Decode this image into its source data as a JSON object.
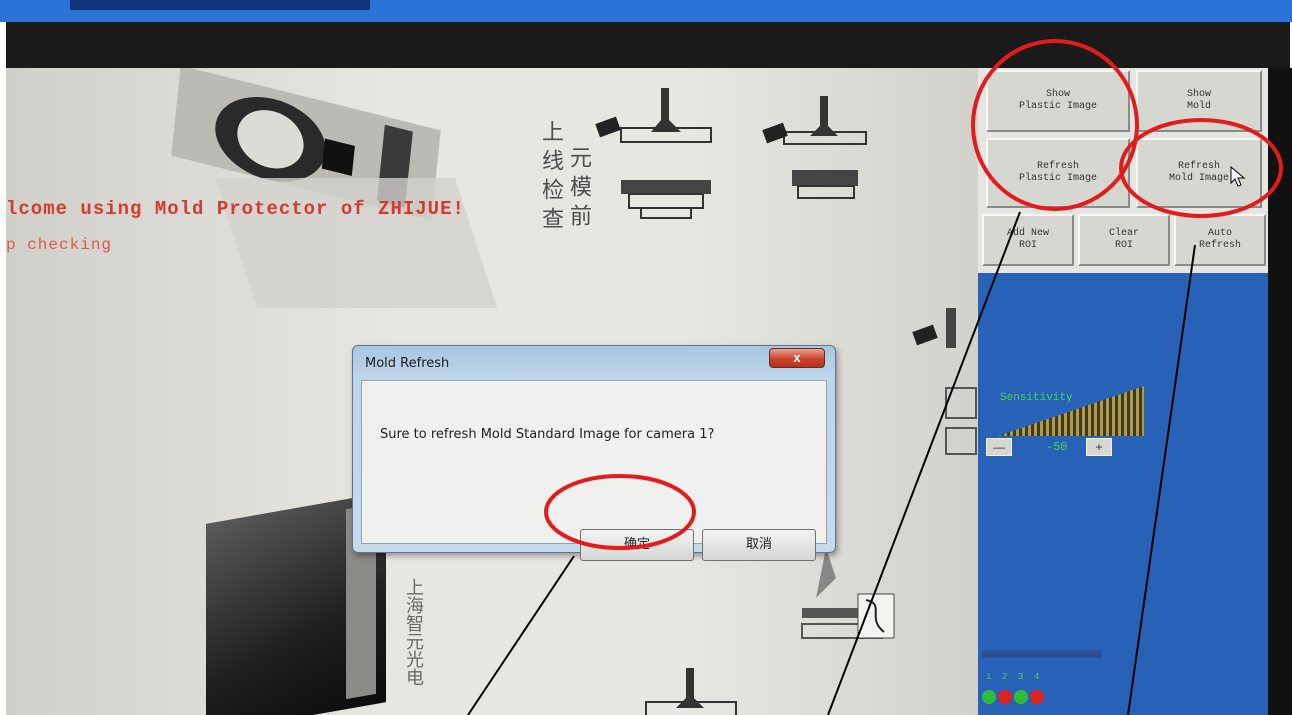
{
  "window": {
    "title_bar_color": "#2a73d6"
  },
  "screen": {
    "welcome_line": "lcome using Mold Protector of ZHIJUE!",
    "status_line": "p checking",
    "vertical_text": [
      "上 线 检 查",
      "元 模 前"
    ],
    "camera_label": "上海智元光电",
    "text_color": "#d63a2e"
  },
  "panel": {
    "buttons": {
      "show_plastic": "Show\nPlastic Image",
      "show_mold": "Show\nMold",
      "refresh_plastic": "Refresh\nPlastic Image",
      "refresh_mold": "Refresh\nMold Image",
      "add_roi": "Add New\nROI",
      "clear_roi": "Clear\nROI",
      "auto_refresh": "Auto\nRefresh"
    },
    "sensitivity": {
      "label": "Sensitivity",
      "minus": "—",
      "value": "-50",
      "plus": "+"
    },
    "dots": [
      {
        "num": "1",
        "color": "#2ebd3a"
      },
      {
        "num": "2",
        "color": "#e02020"
      },
      {
        "num": "3",
        "color": "#2ebd3a"
      },
      {
        "num": "4",
        "color": "#e02020"
      }
    ],
    "background": "#2862b6"
  },
  "dialog": {
    "title": "Mold Refresh",
    "close": "x",
    "message": "Sure to refresh Mold Standard Image for camera 1?",
    "ok": "确定",
    "cancel": "取消"
  },
  "annotations": {
    "circle_color": "#e41b1b",
    "line_color": "#000000"
  }
}
